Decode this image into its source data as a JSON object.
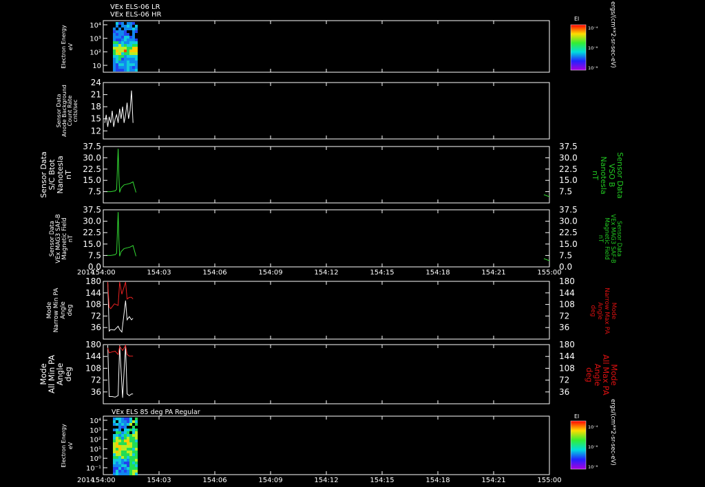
{
  "colors": {
    "background": "#000000",
    "axis": "#ffffff",
    "white_trace": "#ffffff",
    "green_trace": "#33dd33",
    "red_trace": "#ee2222",
    "green_label": "#22cc22",
    "red_label": "#dd1111"
  },
  "header": {
    "line1": "VEx ELS-06 LR",
    "line2": "VEx ELS-06 HR"
  },
  "x_axis": {
    "year": "2014",
    "ticks": [
      "154:00",
      "154:03",
      "154:06",
      "154:09",
      "154:12",
      "154:15",
      "154:18",
      "154:21",
      "155:00"
    ]
  },
  "colorbar": {
    "title": "El",
    "ticks": [
      "10⁻⁴",
      "10⁻⁶",
      "10⁻⁸"
    ],
    "units": "ergs/(cm**2-sr-sec-eV)"
  },
  "bottom_panel_title": "VEx ELS 85 deg PA Regular",
  "chart_data": [
    {
      "type": "heatmap",
      "panel": "Electron Energy (ELS-06)",
      "ylabel": [
        "Electron Energy",
        "eV"
      ],
      "yscale": "log",
      "yticks": [
        "10⁴",
        "10³",
        "10²",
        "10"
      ],
      "x_extent_minutes": [
        0,
        4.3
      ],
      "colorbar": "log10 flux 1e-8 to 1e-4 ergs/(cm**2-sr-sec-eV)"
    },
    {
      "type": "line",
      "panel": "Anode Background",
      "ylabel": [
        "Sensor Data",
        "Anode Background",
        "Count Rate",
        "cnts/sec"
      ],
      "ylim": [
        10,
        24
      ],
      "yticks": [
        "24",
        "21",
        "18",
        "15",
        "12"
      ],
      "series": [
        {
          "color": "white",
          "x": [
            0.2,
            0.4,
            0.6,
            0.8,
            1.0,
            1.2,
            1.4,
            1.6,
            1.8,
            2.0,
            2.2,
            2.4,
            2.6,
            2.8,
            3.0,
            3.2,
            3.4,
            3.6,
            3.8,
            4.0
          ],
          "values": [
            14,
            16,
            13,
            15.5,
            14,
            17,
            13,
            15,
            16,
            14,
            17.5,
            15,
            18,
            14,
            16,
            19,
            15,
            17,
            22,
            14
          ]
        }
      ]
    },
    {
      "type": "line",
      "panel": "S/C Btot",
      "ylabel": [
        "Sensor Data",
        "S/C Btot",
        "Nanotesla",
        "nT"
      ],
      "ylabel_right": [
        "Sensor Data",
        "VSO B",
        "Nanotesla",
        "nT"
      ],
      "ylim": [
        0,
        37.5
      ],
      "yticks": [
        "37.5",
        "30.0",
        "22.5",
        "15.0",
        "7.5"
      ],
      "series": [
        {
          "color": "green",
          "x": [
            0.4,
            1.0,
            1.6,
            1.8,
            2.0,
            2.1,
            2.2,
            2.4,
            2.8,
            3.2,
            3.6,
            4.0,
            4.4
          ],
          "values": [
            7.5,
            7.5,
            8,
            9,
            36,
            18,
            7,
            10,
            12,
            12.5,
            13,
            14,
            7
          ]
        }
      ]
    },
    {
      "type": "line",
      "panel": "VEx MAG3 SAF-B",
      "ylabel": [
        "Sensor Data",
        "VEx MAG3 SAF-B",
        "Magnetic Field",
        "nT"
      ],
      "ylabel_right": [
        "Sensor Data",
        "VEx MAG3 SAF-B",
        "Magnetic Field",
        "nT"
      ],
      "ylim": [
        0,
        37.5
      ],
      "yticks": [
        "37.5",
        "30.0",
        "22.5",
        "15.0",
        "7.5",
        "0.0"
      ],
      "series": [
        {
          "color": "green",
          "x": [
            0.4,
            1.0,
            1.6,
            1.8,
            2.0,
            2.1,
            2.2,
            2.4,
            2.8,
            3.2,
            3.6,
            4.0,
            4.4
          ],
          "values": [
            7.5,
            7.5,
            8,
            9,
            36,
            18,
            7,
            10,
            12,
            12.5,
            13,
            14,
            7
          ]
        }
      ]
    },
    {
      "type": "line",
      "panel": "Narrow PA",
      "ylabel": [
        "Mode",
        "Narrow Min PA",
        "Angle",
        "deg"
      ],
      "ylabel_right": [
        "Mode",
        "Narrow Max PA",
        "Angle",
        "deg"
      ],
      "ylim": [
        0,
        180
      ],
      "yticks": [
        "180",
        "144",
        "108",
        "72",
        "36"
      ],
      "series": [
        {
          "name": "Min PA",
          "color": "white",
          "x": [
            0.6,
            0.8,
            1.0,
            1.5,
            2.0,
            2.2,
            2.5,
            3.0,
            3.2,
            3.5,
            3.8,
            4.0
          ],
          "values": [
            180,
            25,
            30,
            28,
            40,
            30,
            22,
            120,
            60,
            70,
            60,
            65
          ]
        },
        {
          "name": "Max PA",
          "color": "red",
          "x": [
            0.6,
            0.8,
            1.0,
            1.5,
            2.0,
            2.2,
            2.5,
            3.0,
            3.2,
            3.5,
            3.8,
            4.0
          ],
          "values": [
            180,
            100,
            95,
            110,
            105,
            180,
            140,
            180,
            125,
            130,
            130,
            125
          ]
        }
      ]
    },
    {
      "type": "line",
      "panel": "All PA",
      "ylabel": [
        "Mode",
        "All Min PA",
        "Angle",
        "deg"
      ],
      "ylabel_right": [
        "Mode",
        "All Max PA",
        "Angle",
        "deg"
      ],
      "ylim": [
        0,
        180
      ],
      "yticks": [
        "180",
        "144",
        "108",
        "72",
        "36"
      ],
      "series": [
        {
          "name": "Min PA",
          "color": "white",
          "x": [
            0.6,
            0.8,
            1.2,
            1.6,
            2.0,
            2.2,
            2.6,
            3.0,
            3.2,
            3.5,
            3.8,
            4.0
          ],
          "values": [
            180,
            22,
            22,
            20,
            25,
            180,
            18,
            180,
            30,
            25,
            30,
            30
          ]
        },
        {
          "name": "Max PA",
          "color": "red",
          "x": [
            0.6,
            0.8,
            1.2,
            1.6,
            2.0,
            2.2,
            2.6,
            3.0,
            3.2,
            3.5,
            3.8,
            4.0
          ],
          "values": [
            170,
            155,
            158,
            160,
            150,
            175,
            162,
            178,
            150,
            145,
            145,
            145
          ]
        }
      ]
    },
    {
      "type": "heatmap",
      "panel": "Electron Energy (85 deg PA)",
      "ylabel": [
        "Electron Energy",
        "eV"
      ],
      "yscale": "log",
      "yticks": [
        "10⁴",
        "10³",
        "10²",
        "10¹",
        "10⁰",
        "10⁻¹"
      ],
      "x_extent_minutes": [
        0,
        4.3
      ]
    }
  ]
}
